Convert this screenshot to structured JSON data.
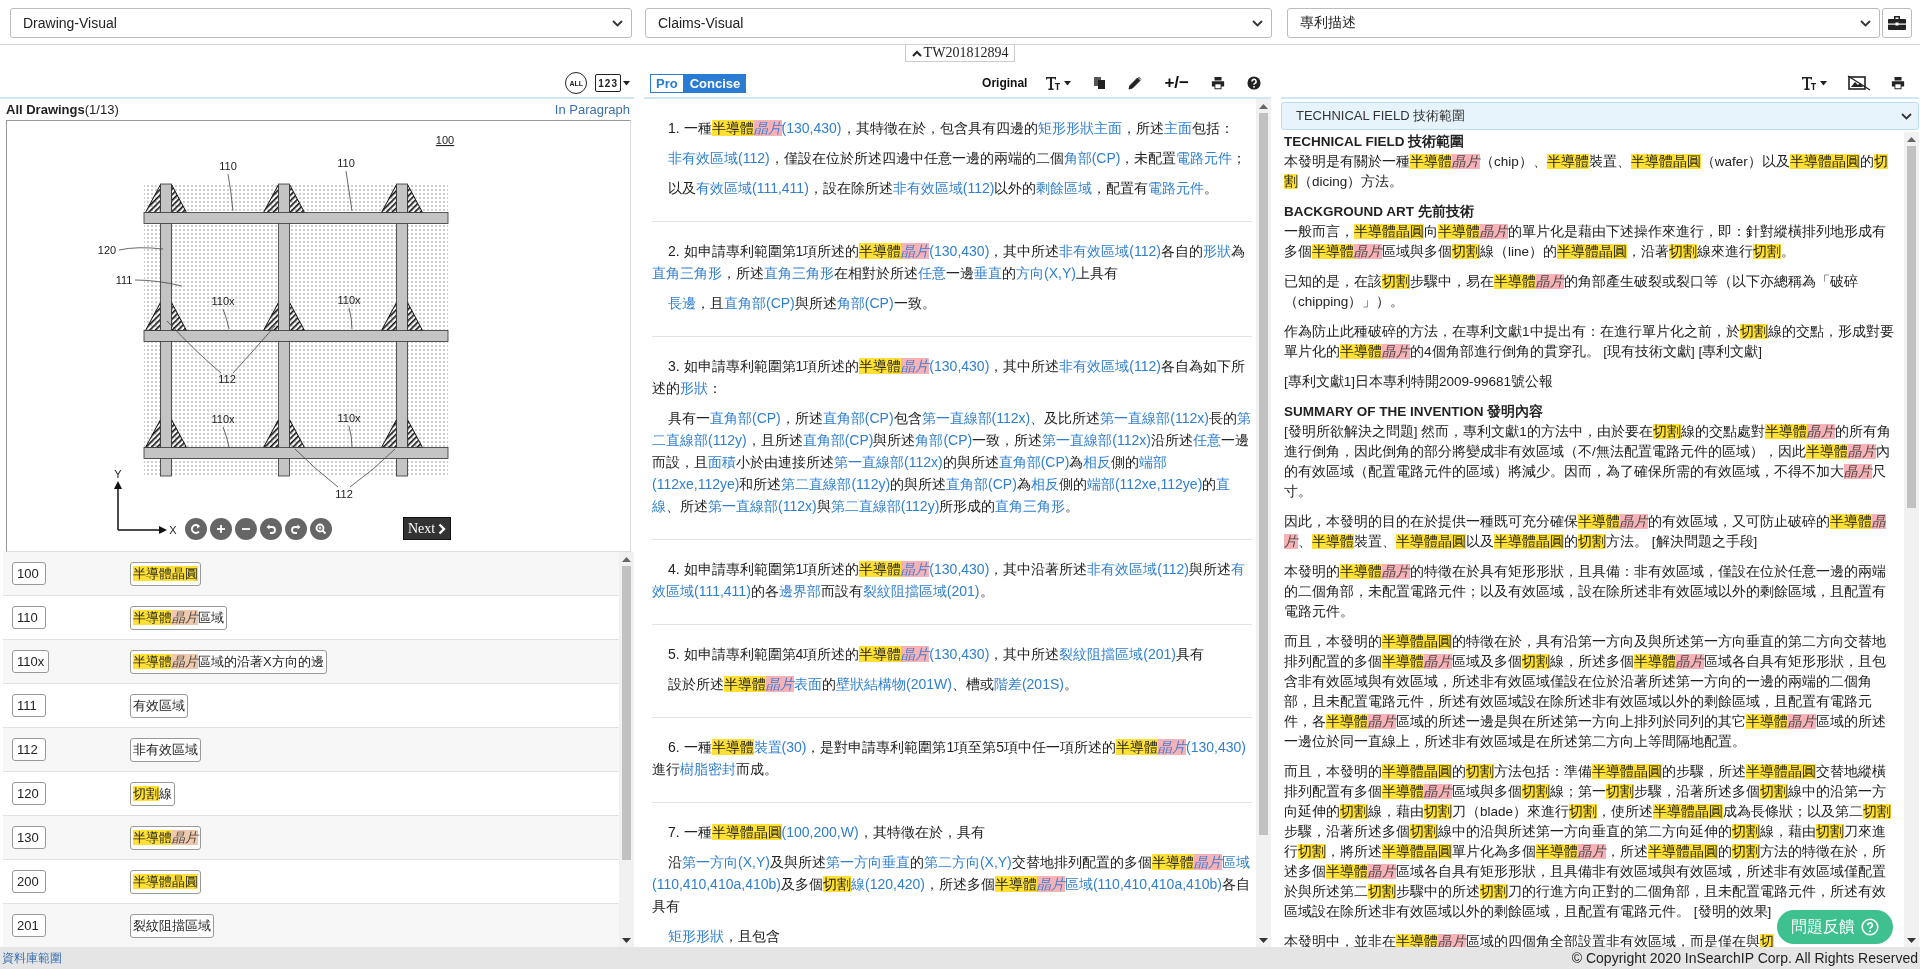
{
  "selectors": [
    {
      "value": "Drawing-Visual"
    },
    {
      "value": "Claims-Visual"
    },
    {
      "value": "專利描述"
    }
  ],
  "patent_tab": {
    "number": "TW201812894"
  },
  "drawings_panel": {
    "toolbar": {
      "all_text": "ALL",
      "number_text": "123"
    },
    "title": "**All Drawings**(1/13)",
    "paragraph_link": "In Paragraph",
    "figure": {
      "labels": [
        "100",
        "110",
        "110",
        "120",
        "111",
        "110x",
        "110x",
        "110x",
        "110x",
        "112",
        "112"
      ],
      "axis_labels": [
        "Y",
        "X"
      ]
    },
    "next_button": "Next",
    "references": [
      {
        "number": "100",
        "label": [
          {
            "kind": "hl",
            "text": "半導體晶圓"
          }
        ]
      },
      {
        "number": "110",
        "label": [
          {
            "kind": "hl",
            "text": "半導體"
          },
          {
            "kind": "chip",
            "text": "晶片"
          },
          "區域"
        ]
      },
      {
        "number": "110x",
        "label": [
          {
            "kind": "hl",
            "text": "半導體"
          },
          {
            "kind": "chip",
            "text": "晶片"
          },
          "區域的沿著X方向的邊"
        ]
      },
      {
        "number": "111",
        "label": [
          "有效區域"
        ]
      },
      {
        "number": "112",
        "label": [
          "非有效區域"
        ]
      },
      {
        "number": "120",
        "label": [
          {
            "kind": "hl",
            "text": "切割"
          },
          "線"
        ]
      },
      {
        "number": "130",
        "label": [
          {
            "kind": "hl",
            "text": "半導體"
          },
          {
            "kind": "chip",
            "text": "晶片"
          }
        ]
      },
      {
        "number": "200",
        "label": [
          {
            "kind": "hl",
            "text": "半導體晶圓"
          }
        ]
      },
      {
        "number": "201",
        "label": [
          "裂紋阻擋區域"
        ]
      }
    ]
  },
  "claims_panel": {
    "modes": [
      {
        "label": "Pro",
        "selected": false
      },
      {
        "label": "Concise",
        "selected": true
      }
    ],
    "original_label": "Original",
    "expand_label": "+/−",
    "claims": [
      {
        "paragraphs": [
          [
            "1. 一種",
            {
              "kind": "hl",
              "text": "半導體"
            },
            {
              "kind": "chip",
              "text": "晶片"
            },
            {
              "kind": "term",
              "text": "(130,430)"
            },
            "，其特徵在於，包含具有四邊的",
            {
              "kind": "term",
              "text": "矩形形狀主面"
            },
            "，所述",
            {
              "kind": "term",
              "text": "主面"
            },
            "包括："
          ],
          [
            {
              "kind": "term",
              "text": "非有效區域(112)"
            },
            "，僅設在位於所述四邊中任意一邊的兩端的二個",
            {
              "kind": "term",
              "text": "角部(CP)"
            },
            "，未配置",
            {
              "kind": "term",
              "text": "電路元件"
            },
            "；"
          ],
          [
            "以及",
            {
              "kind": "term",
              "text": "有效區域(111,411)"
            },
            "，設在除所述",
            {
              "kind": "term",
              "text": "非有效區域(112)"
            },
            "以外的",
            {
              "kind": "term",
              "text": "剩餘區域"
            },
            "，配置有",
            {
              "kind": "term",
              "text": "電路元件"
            },
            "。"
          ]
        ]
      },
      {
        "paragraphs": [
          [
            "2. 如申請專利範圍第1項所述的",
            {
              "kind": "hl",
              "text": "半導體"
            },
            {
              "kind": "chip",
              "text": "晶片"
            },
            {
              "kind": "term",
              "text": "(130,430)"
            },
            "，其中所述",
            {
              "kind": "term",
              "text": "非有效區域(112)"
            },
            "各自的",
            {
              "kind": "term",
              "text": "形狀"
            },
            "為",
            {
              "kind": "term",
              "text": "直角三角形"
            },
            "，所述",
            {
              "kind": "term",
              "text": "直角三角形"
            },
            "在相對於所述",
            {
              "kind": "term",
              "text": "任意"
            },
            "一邊",
            {
              "kind": "term",
              "text": "垂直"
            },
            "的",
            {
              "kind": "term",
              "text": "方向(X,Y)"
            },
            "上具有"
          ],
          [
            {
              "kind": "term",
              "text": "長邊"
            },
            "，且",
            {
              "kind": "term",
              "text": "直角部(CP)"
            },
            "與所述",
            {
              "kind": "term",
              "text": "角部(CP)"
            },
            "一致。"
          ]
        ]
      },
      {
        "paragraphs": [
          [
            "3. 如申請專利範圍第1項所述的",
            {
              "kind": "hl",
              "text": "半導體"
            },
            {
              "kind": "chip",
              "text": "晶片"
            },
            {
              "kind": "term",
              "text": "(130,430)"
            },
            "，其中所述",
            {
              "kind": "term",
              "text": "非有效區域(112)"
            },
            "各自為如下所述的",
            {
              "kind": "term",
              "text": "形狀"
            },
            "："
          ],
          [
            "具有一",
            {
              "kind": "term",
              "text": "直角部(CP)"
            },
            "，所述",
            {
              "kind": "term",
              "text": "直角部(CP)"
            },
            "包含",
            {
              "kind": "term",
              "text": "第一直線部(112x)"
            },
            "、及比所述",
            {
              "kind": "term",
              "text": "第一直線部(112x)"
            },
            "長的",
            {
              "kind": "term",
              "text": "第二直線部(112y)"
            },
            "，且所述",
            {
              "kind": "term",
              "text": "直角部(CP)"
            },
            "與所述",
            {
              "kind": "term",
              "text": "角部(CP)"
            },
            "一致，所述",
            {
              "kind": "term",
              "text": "第一直線部(112x)"
            },
            "沿所述",
            {
              "kind": "term",
              "text": "任意"
            },
            "一邊而設，且",
            {
              "kind": "term",
              "text": "面積"
            },
            "小於由連接所述",
            {
              "kind": "term",
              "text": "第一直線部(112x)"
            },
            "的與所述",
            {
              "kind": "term",
              "text": "直角部(CP)"
            },
            "為",
            {
              "kind": "term",
              "text": "相反"
            },
            "側的",
            {
              "kind": "term",
              "text": "端部(112xe,112ye)"
            },
            "和所述",
            {
              "kind": "term",
              "text": "第二直線部(112y)"
            },
            "的與所述",
            {
              "kind": "term",
              "text": "直角部(CP)"
            },
            "為",
            {
              "kind": "term",
              "text": "相反"
            },
            "側的",
            {
              "kind": "term",
              "text": "端部(112xe,112ye)"
            },
            "的",
            {
              "kind": "term",
              "text": "直線"
            },
            "、所述",
            {
              "kind": "term",
              "text": "第一直線部(112x)"
            },
            "與",
            {
              "kind": "term",
              "text": "第二直線部(112y)"
            },
            "所形成的",
            {
              "kind": "term",
              "text": "直角三角形"
            },
            "。"
          ]
        ]
      },
      {
        "paragraphs": [
          [
            "4. 如申請專利範圍第1項所述的",
            {
              "kind": "hl",
              "text": "半導體"
            },
            {
              "kind": "chip",
              "text": "晶片"
            },
            {
              "kind": "term",
              "text": "(130,430)"
            },
            "，其中沿著所述",
            {
              "kind": "term",
              "text": "非有效區域(112)"
            },
            "與所述",
            {
              "kind": "term",
              "text": "有效區域(111,411)"
            },
            "的各",
            {
              "kind": "term",
              "text": "邊界部"
            },
            "而設有",
            {
              "kind": "term",
              "text": "裂紋阻擋區域(201)"
            },
            "。"
          ]
        ]
      },
      {
        "paragraphs": [
          [
            "5. 如申請專利範圍第4項所述的",
            {
              "kind": "hl",
              "text": "半導體"
            },
            {
              "kind": "chip",
              "text": "晶片"
            },
            {
              "kind": "term",
              "text": "(130,430)"
            },
            "，其中所述",
            {
              "kind": "term",
              "text": "裂紋阻擋區域(201)"
            },
            "具有"
          ],
          [
            "設於所述",
            {
              "kind": "hl",
              "text": "半導體"
            },
            {
              "kind": "chip",
              "text": "晶片"
            },
            {
              "kind": "term",
              "text": "表面"
            },
            "的",
            {
              "kind": "term",
              "text": "壁狀結構物(201W)"
            },
            "、槽或",
            {
              "kind": "term",
              "text": "階差(201S)"
            },
            "。"
          ]
        ]
      },
      {
        "paragraphs": [
          [
            "6. 一種",
            {
              "kind": "hl",
              "text": "半導體"
            },
            {
              "kind": "term",
              "text": "裝置(30)"
            },
            "，是對申請專利範圍第1項至第5項中任一項所述的",
            {
              "kind": "hl",
              "text": "半導體"
            },
            {
              "kind": "chip",
              "text": "晶片"
            },
            {
              "kind": "term",
              "text": "(130,430)"
            },
            "進行",
            {
              "kind": "term",
              "text": "樹脂密封"
            },
            "而成。"
          ]
        ]
      },
      {
        "paragraphs": [
          [
            "7. 一種",
            {
              "kind": "hl",
              "text": "半導體晶圓"
            },
            {
              "kind": "term",
              "text": "(100,200,W)"
            },
            "，其特徵在於，具有"
          ],
          [
            "沿",
            {
              "kind": "term",
              "text": "第一方向(X,Y)"
            },
            "及與所述",
            {
              "kind": "term",
              "text": "第一方向垂直"
            },
            "的",
            {
              "kind": "term",
              "text": "第二方向(X,Y)"
            },
            "交替地排列配置的多個",
            {
              "kind": "hl",
              "text": "半導體"
            },
            {
              "kind": "chip",
              "text": "晶片"
            },
            {
              "kind": "term",
              "text": "區域(110,410,410a,410b)"
            },
            "及多個",
            {
              "kind": "hl",
              "text": "切割"
            },
            {
              "kind": "term",
              "text": "線(120,420)"
            },
            "，所述多個",
            {
              "kind": "hl",
              "text": "半導體"
            },
            {
              "kind": "chip",
              "text": "晶片"
            },
            {
              "kind": "term",
              "text": "區域(110,410,410a,410b)"
            },
            "各自具有"
          ],
          [
            {
              "kind": "term",
              "text": "矩形形狀"
            },
            "，且包含"
          ]
        ]
      }
    ]
  },
  "description_panel": {
    "section_select": "TECHNICAL FIELD 技術範圍",
    "blocks": [
      {
        "kind": "heading",
        "text": "TECHNICAL FIELD 技術範圍"
      },
      {
        "kind": "paragraph",
        "segments": [
          "本發明是有關於一種",
          {
            "kind": "hl",
            "text": "半導體"
          },
          {
            "kind": "chip",
            "text": "晶片"
          },
          "（chip）、",
          {
            "kind": "hl",
            "text": "半導體"
          },
          "裝置、",
          {
            "kind": "hl",
            "text": "半導體晶圓"
          },
          "（wafer）以及",
          {
            "kind": "hl",
            "text": "半導體晶圓"
          },
          "的",
          {
            "kind": "hl",
            "text": "切割"
          },
          "（dicing）方法。"
        ]
      },
      {
        "kind": "heading",
        "text": "BACKGROUND ART 先前技術"
      },
      {
        "kind": "paragraph",
        "segments": [
          "一般而言，",
          {
            "kind": "hl",
            "text": "半導體晶圓"
          },
          "向",
          {
            "kind": "hl",
            "text": "半導體"
          },
          {
            "kind": "chip",
            "text": "晶片"
          },
          "的單片化是藉由下述操作來進行，即：針對縱橫排列地形成有多個",
          {
            "kind": "hl",
            "text": "半導體"
          },
          {
            "kind": "chip",
            "text": "晶片"
          },
          "區域與多個",
          {
            "kind": "hl",
            "text": "切割"
          },
          "線（line）的",
          {
            "kind": "hl",
            "text": "半導體晶圓"
          },
          "，沿著",
          {
            "kind": "hl",
            "text": "切割"
          },
          "線來進行",
          {
            "kind": "hl",
            "text": "切割"
          },
          "。"
        ]
      },
      {
        "kind": "paragraph",
        "segments": [
          "已知的是，在該",
          {
            "kind": "hl",
            "text": "切割"
          },
          "步驟中，易在",
          {
            "kind": "hl",
            "text": "半導體"
          },
          {
            "kind": "chip",
            "text": "晶片"
          },
          "的角部產生破裂或裂口等（以下亦總稱為「破碎（chipping）」）。"
        ]
      },
      {
        "kind": "paragraph",
        "segments": [
          "作為防止此種破碎的方法，在專利文獻1中提出有：在進行單片化之前，於",
          {
            "kind": "hl",
            "text": "切割"
          },
          "線的交點，形成對要單片化的",
          {
            "kind": "hl",
            "text": "半導體"
          },
          {
            "kind": "chip",
            "text": "晶片"
          },
          "的4個角部進行倒角的貫穿孔。 [現有技術文獻] [專利文獻]"
        ]
      },
      {
        "kind": "paragraph",
        "segments": [
          "[專利文獻1]日本專利特開2009-99681號公報"
        ]
      },
      {
        "kind": "heading",
        "text": "SUMMARY OF THE INVENTION 發明內容"
      },
      {
        "kind": "paragraph",
        "segments": [
          "[發明所欲解決之問題] 然而，專利文獻1的方法中，由於要在",
          {
            "kind": "hl",
            "text": "切割"
          },
          "線的交點處對",
          {
            "kind": "hl",
            "text": "半導體"
          },
          {
            "kind": "chip",
            "text": "晶片"
          },
          "的所有角進行倒角，因此倒角的部分將變成非有效區域（不/無法配置電路元件的區域），因此",
          {
            "kind": "hl",
            "text": "半導體"
          },
          {
            "kind": "chip",
            "text": "晶片"
          },
          "內的有效區域（配置電路元件的區域）將減少。因而，為了確保所需的有效區域，不得不加大",
          {
            "kind": "chip",
            "text": "晶片"
          },
          "尺寸。"
        ]
      },
      {
        "kind": "paragraph",
        "segments": [
          "因此，本發明的目的在於提供一種既可充分確保",
          {
            "kind": "hl",
            "text": "半導體"
          },
          {
            "kind": "chip",
            "text": "晶片"
          },
          "的有效區域，又可防止破碎的",
          {
            "kind": "hl",
            "text": "半導體"
          },
          {
            "kind": "chip",
            "text": "晶片"
          },
          "、",
          {
            "kind": "hl",
            "text": "半導體"
          },
          "裝置、",
          {
            "kind": "hl",
            "text": "半導體晶圓"
          },
          "以及",
          {
            "kind": "hl",
            "text": "半導體晶圓"
          },
          "的",
          {
            "kind": "hl",
            "text": "切割"
          },
          "方法。 [解決問題之手段]"
        ]
      },
      {
        "kind": "paragraph",
        "segments": [
          "本發明的",
          {
            "kind": "hl",
            "text": "半導體"
          },
          {
            "kind": "chip",
            "text": "晶片"
          },
          "的特徵在於具有矩形形狀，且具備：非有效區域，僅設在位於任意一邊的兩端的二個角部，未配置電路元件；以及有效區域，設在除所述非有效區域以外的剩餘區域，且配置有電路元件。"
        ]
      },
      {
        "kind": "paragraph",
        "segments": [
          "而且，本發明的",
          {
            "kind": "hl",
            "text": "半導體晶圓"
          },
          "的特徵在於，具有沿第一方向及與所述第一方向垂直的第二方向交替地排列配置的多個",
          {
            "kind": "hl",
            "text": "半導體"
          },
          {
            "kind": "chip",
            "text": "晶片"
          },
          "區域及多個",
          {
            "kind": "hl",
            "text": "切割"
          },
          "線，所述多個",
          {
            "kind": "hl",
            "text": "半導體"
          },
          {
            "kind": "chip",
            "text": "晶片"
          },
          "區域各自具有矩形形狀，且包含非有效區域與有效區域，所述非有效區域僅設在位於沿著所述第一方向的一邊的兩端的二個角部，且未配置電路元件，所述有效區域設在除所述非有效區域以外的剩餘區域，且配置有電路元件，各",
          {
            "kind": "hl",
            "text": "半導體"
          },
          {
            "kind": "chip",
            "text": "晶片"
          },
          "區域的所述一邊是與在所述第一方向上排列於同列的其它",
          {
            "kind": "hl",
            "text": "半導體"
          },
          {
            "kind": "chip",
            "text": "晶片"
          },
          "區域的所述一邊位於同一直線上，所述非有效區域是在所述第二方向上等間隔地配置。"
        ]
      },
      {
        "kind": "paragraph",
        "segments": [
          "而且，本發明的",
          {
            "kind": "hl",
            "text": "半導體晶圓"
          },
          "的",
          {
            "kind": "hl",
            "text": "切割"
          },
          "方法包括：準備",
          {
            "kind": "hl",
            "text": "半導體晶圓"
          },
          "的步驟，所述",
          {
            "kind": "hl",
            "text": "半導體晶圓"
          },
          "交替地縱橫排列配置有多個",
          {
            "kind": "hl",
            "text": "半導體"
          },
          {
            "kind": "chip",
            "text": "晶片"
          },
          "區域與多個",
          {
            "kind": "hl",
            "text": "切割"
          },
          "線；第一",
          {
            "kind": "hl",
            "text": "切割"
          },
          "步驟，沿著所述多個",
          {
            "kind": "hl",
            "text": "切割"
          },
          "線中的沿第一方向延伸的",
          {
            "kind": "hl",
            "text": "切割"
          },
          "線，藉由",
          {
            "kind": "hl",
            "text": "切割"
          },
          "刀（blade）來進行",
          {
            "kind": "hl",
            "text": "切割"
          },
          "，使所述",
          {
            "kind": "hl",
            "text": "半導體晶圓"
          },
          "成為長條狀；以及第二",
          {
            "kind": "hl",
            "text": "切割"
          },
          "步驟，沿著所述多個",
          {
            "kind": "hl",
            "text": "切割"
          },
          "線中的沿與所述第一方向垂直的第二方向延伸的",
          {
            "kind": "hl",
            "text": "切割"
          },
          "線，藉由",
          {
            "kind": "hl",
            "text": "切割"
          },
          "刀來進行",
          {
            "kind": "hl",
            "text": "切割"
          },
          "，將所述",
          {
            "kind": "hl",
            "text": "半導體晶圓"
          },
          "單片化為多個",
          {
            "kind": "hl",
            "text": "半導體"
          },
          {
            "kind": "chip",
            "text": "晶片"
          },
          "，所述",
          {
            "kind": "hl",
            "text": "半導體晶圓"
          },
          "的",
          {
            "kind": "hl",
            "text": "切割"
          },
          "方法的特徵在於，所述多個",
          {
            "kind": "hl",
            "text": "半導體"
          },
          {
            "kind": "chip",
            "text": "晶片"
          },
          "區域各自具有矩形形狀，且具備非有效區域與有效區域，所述非有效區域僅配置於與所述第二",
          {
            "kind": "hl",
            "text": "切割"
          },
          "步驟中的所述",
          {
            "kind": "hl",
            "text": "切割"
          },
          "刀的行進方向正對的二個角部，且未配置電路元件，所述有效區域設在除所述非有效區域以外的剩餘區域，且配置有電路元件。 [發明的效果]"
        ]
      },
      {
        "kind": "paragraph",
        "segments": [
          "本發明中，並非在",
          {
            "kind": "hl",
            "text": "半導體"
          },
          {
            "kind": "chip",
            "text": "晶片"
          },
          "區域的四個角全部設置非有效區域，而是僅在與",
          {
            "kind": "hl",
            "text": "切"
          }
        ]
      }
    ]
  },
  "footer": {
    "scope_link": "資料庫範圍",
    "copyright": "© Copyright 2020 InSearchIP Corp. All Rights Reserved"
  },
  "feedback_button": "問題反饋"
}
